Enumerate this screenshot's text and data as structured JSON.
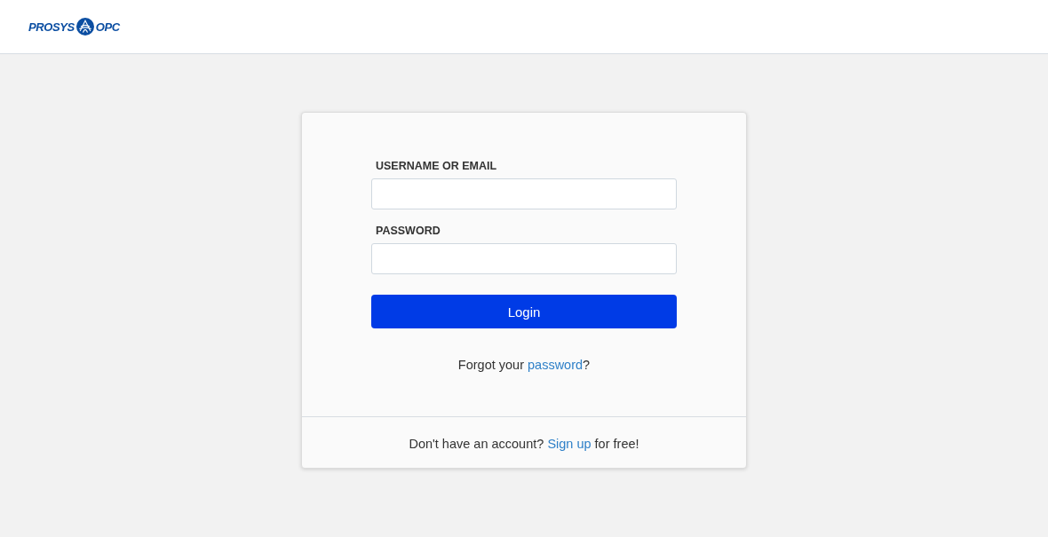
{
  "header": {
    "logo": {
      "word_left": "PROSYS",
      "word_right": "OPC"
    }
  },
  "login_form": {
    "fields": [
      {
        "label": "USERNAME OR EMAIL"
      },
      {
        "label": "PASSWORD"
      }
    ],
    "submit": "Login",
    "forgot": {
      "prefix": "Forgot your ",
      "link": "password",
      "suffix": "?"
    }
  },
  "footer": {
    "prefix": "Don't have an account? ",
    "link": "Sign up",
    "suffix": " for free!"
  }
}
